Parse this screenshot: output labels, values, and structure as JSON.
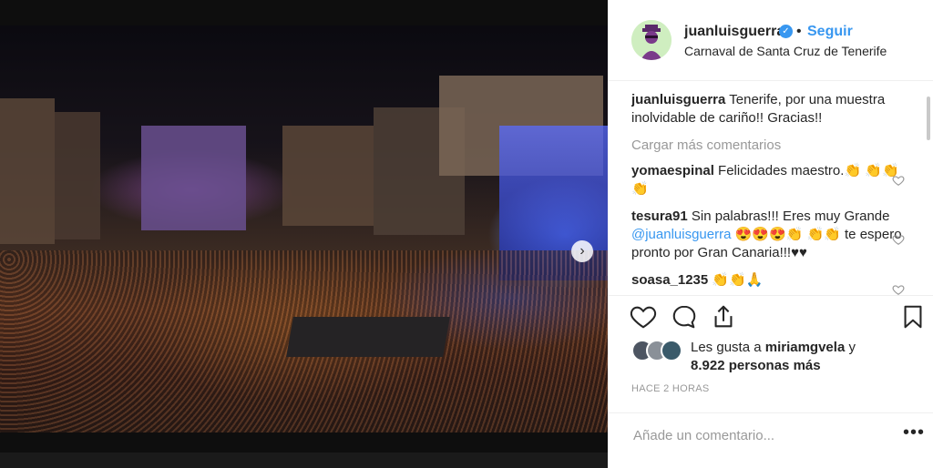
{
  "post": {
    "username": "juanluisguerra",
    "follow_label": "Seguir",
    "location": "Carnaval de Santa Cruz de Tenerife",
    "caption": {
      "user": "juanluisguerra",
      "text": "Tenerife, por una muestra inolvidable de cariño!! Gracias!!"
    },
    "load_more": "Cargar más comentarios",
    "comments": [
      {
        "user": "yomaespinal",
        "text": "Felicidades maestro.👏 👏👏👏"
      },
      {
        "user": "tesura91",
        "text_before": "Sin palabras!!! Eres muy Grande ",
        "mention": "@juanluisguerra",
        "text_after": " 😍😍😍👏 👏👏 te espero pronto por Gran Canaria!!!♥♥"
      },
      {
        "user": "soasa_1235",
        "text": "👏👏🙏"
      }
    ],
    "likes": {
      "line1": "Les gusta a ",
      "user": "miriamgvela",
      "line1_end": " y",
      "line2": "8.922 personas más"
    },
    "timestamp": "HACE 2 HORAS",
    "comment_placeholder": "Añade un comentario...",
    "more_label": "•••"
  },
  "icons": {
    "like": "heart-icon",
    "comment": "comment-icon",
    "share": "share-icon",
    "save": "bookmark-icon",
    "verified": "verified-badge-icon"
  },
  "colors": {
    "link": "#3897f0",
    "text": "#262626",
    "muted": "#999999"
  }
}
